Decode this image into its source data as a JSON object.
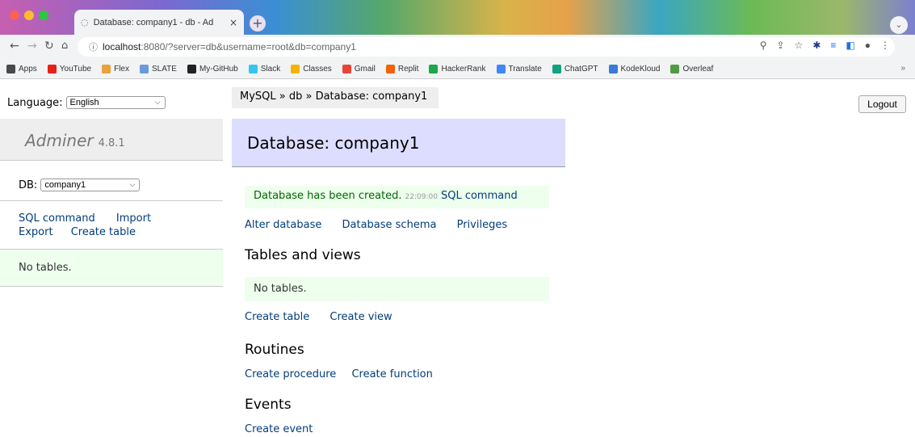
{
  "browser": {
    "tab_title": "Database: company1 - db - Ad",
    "tab_close": "×",
    "new_tab": "+",
    "url_host": "localhost",
    "url_rest": ":8080/?server=db&username=root&db=company1",
    "bookmarks": [
      {
        "label": "Apps",
        "color": "#4a4a4a"
      },
      {
        "label": "YouTube",
        "color": "#e62117"
      },
      {
        "label": "Flex",
        "color": "#e9a23b"
      },
      {
        "label": "SLATE",
        "color": "#6a9bd8"
      },
      {
        "label": "My-GitHub",
        "color": "#222222"
      },
      {
        "label": "Slack",
        "color": "#36c5f0"
      },
      {
        "label": "Classes",
        "color": "#f4b400"
      },
      {
        "label": "Gmail",
        "color": "#ea4335"
      },
      {
        "label": "Replit",
        "color": "#f26207"
      },
      {
        "label": "HackerRank",
        "color": "#1ba94c"
      },
      {
        "label": "Translate",
        "color": "#4285f4"
      },
      {
        "label": "ChatGPT",
        "color": "#10a37f"
      },
      {
        "label": "KodeKloud",
        "color": "#3a7bd5"
      },
      {
        "label": "Overleaf",
        "color": "#4f9c45"
      }
    ],
    "bookmarks_more": "»"
  },
  "page": {
    "language_label": "Language:",
    "language_value": "English",
    "breadcrumb": "MySQL » db » Database: company1",
    "logout": "Logout",
    "brand": "Adminer",
    "version": "4.8.1",
    "db_label": "DB:",
    "db_value": "company1",
    "side_links": {
      "sql_command": "SQL command",
      "import": "Import",
      "export": "Export",
      "create_table": "Create table"
    },
    "side_empty": "No tables.",
    "title": "Database: company1",
    "message": {
      "text": "Database has been created.",
      "time": "22:09:00",
      "link": "SQL command"
    },
    "db_links": {
      "alter": "Alter database",
      "schema": "Database schema",
      "privileges": "Privileges"
    },
    "tables_heading": "Tables and views",
    "tables_empty": "No tables.",
    "tables_links": {
      "create_table": "Create table",
      "create_view": "Create view"
    },
    "routines_heading": "Routines",
    "routines_links": {
      "create_procedure": "Create procedure",
      "create_function": "Create function"
    },
    "events_heading": "Events",
    "events_link": "Create event"
  },
  "colors": {
    "link": "#003d7a",
    "header_bg": "#ddddff",
    "success_bg": "#eeffee"
  }
}
